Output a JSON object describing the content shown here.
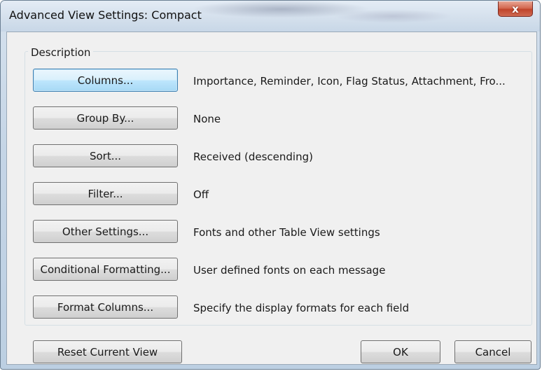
{
  "window": {
    "title": "Advanced View Settings: Compact",
    "close_glyph": "x"
  },
  "group": {
    "label": "Description"
  },
  "rows": [
    {
      "button": "Columns...",
      "description": "Importance, Reminder, Icon, Flag Status, Attachment, Fro..."
    },
    {
      "button": "Group By...",
      "description": "None"
    },
    {
      "button": "Sort...",
      "description": "Received (descending)"
    },
    {
      "button": "Filter...",
      "description": "Off"
    },
    {
      "button": "Other Settings...",
      "description": "Fonts and other Table View settings"
    },
    {
      "button": "Conditional Formatting...",
      "description": "User defined fonts on each message"
    },
    {
      "button": "Format Columns...",
      "description": "Specify the display formats for each field"
    }
  ],
  "footer": {
    "reset_label": "Reset Current View",
    "ok_label": "OK",
    "cancel_label": "Cancel"
  }
}
